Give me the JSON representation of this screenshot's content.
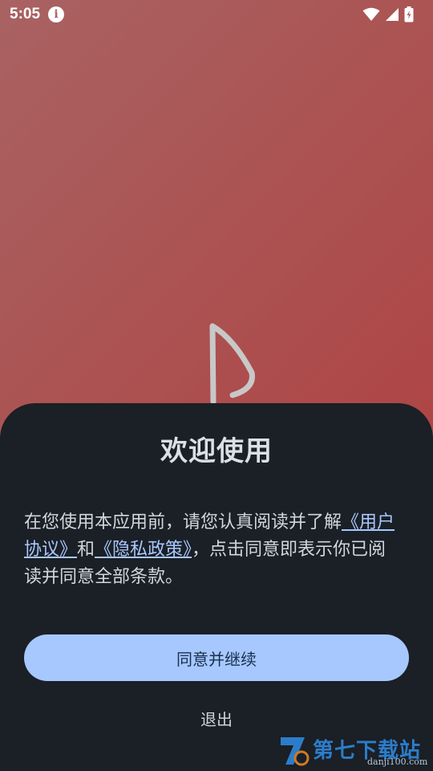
{
  "status_bar": {
    "time": "5:05",
    "icons": [
      "info-icon",
      "wifi-icon",
      "signal-icon",
      "battery-charging-icon"
    ]
  },
  "app": {
    "logo_icon": "app-logo-d-icon"
  },
  "dialog": {
    "title": "欢迎使用",
    "body": {
      "text_before": "在您使用本应用前，请您认真阅读并了解",
      "user_agreement_link": "《用户协议》",
      "conjunction": "和",
      "privacy_policy_link": "《隐私政策》",
      "text_after": "，点击同意即表示你已阅读并同意全部条款。"
    },
    "agree_button": "同意并继续",
    "exit_button": "退出"
  },
  "watermark": {
    "title": "第七下载站",
    "url": "danji100.com"
  },
  "colors": {
    "background_start": "#a96262",
    "background_end": "#b23a3a",
    "sheet": "#1b1f26",
    "accent_button": "#a6c8ff",
    "link": "#a8c8ff"
  }
}
